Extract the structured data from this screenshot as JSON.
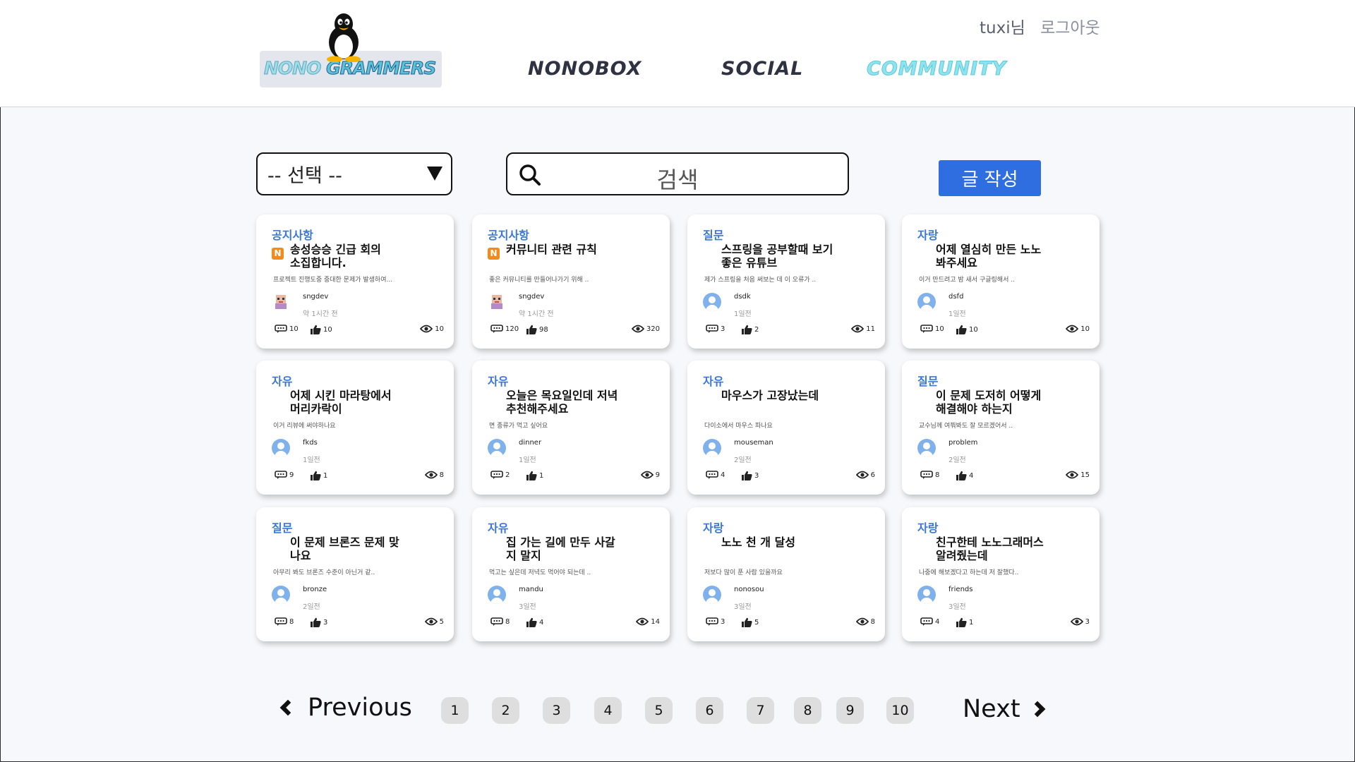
{
  "header": {
    "logo_part1": "NONO",
    "logo_part2": "GRAMMERS",
    "nav": [
      "NONOBOX",
      "SOCIAL",
      "COMMUNITY"
    ],
    "user_name": "tuxi님",
    "logout_label": "로그아웃",
    "active_nav": "COMMUNITY",
    "active_color": "#8fe3ee"
  },
  "toolbar": {
    "select_label": "-- 선택 --",
    "search_placeholder": "검색",
    "write_label": "글 작성",
    "accent_color": "#2f6ee0"
  },
  "posts": [
    {
      "category": "공지사항",
      "notice": true,
      "badge": "N",
      "title": "송성승승 긴급 회의\n소집합니다.",
      "excerpt": "프로젝트 진행도중 중대한 문제가 발생하여...",
      "author": "sngdev",
      "time": "약 1시간 전",
      "comments": "10",
      "likes": "10",
      "views": "10",
      "avatar": "pixel"
    },
    {
      "category": "공지사항",
      "notice": true,
      "badge": "N",
      "title": "커뮤니티 관련 규칙",
      "excerpt": "좋은 커뮤니티를 만들어나가기 위해 ..",
      "author": "sngdev",
      "time": "약 1시간 전",
      "comments": "120",
      "likes": "98",
      "views": "320",
      "avatar": "pixel"
    },
    {
      "category": "질문",
      "notice": false,
      "title": "스프링을 공부할때 보기\n좋은 유튜브",
      "excerpt": "제가 스프링을 처음 써보는 데 이 오류가 ..",
      "author": "dsdk",
      "time": "1일전",
      "comments": "3",
      "likes": "2",
      "views": "11",
      "avatar": "default"
    },
    {
      "category": "자랑",
      "notice": false,
      "title": "어제 열심히 만든 노노\n봐주세요",
      "excerpt": "이거 만드려고 밤 새서 구글링해서 ..",
      "author": "dsfd",
      "time": "1일전",
      "comments": "10",
      "likes": "10",
      "views": "10",
      "avatar": "default"
    },
    {
      "category": "자유",
      "notice": false,
      "title": "어제 시킨 마라탕에서\n머리카락이",
      "excerpt": "이거 리뷰에 써야하나요",
      "author": "fkds",
      "time": "1일전",
      "comments": "9",
      "likes": "1",
      "views": "8",
      "avatar": "default"
    },
    {
      "category": "자유",
      "notice": false,
      "title": "오늘은 목요일인데 저녁\n추천해주세요",
      "excerpt": "면 종류가 먹고 싶어요",
      "author": "dinner",
      "time": "1일전",
      "comments": "2",
      "likes": "1",
      "views": "9",
      "avatar": "default"
    },
    {
      "category": "자유",
      "notice": false,
      "title": "마우스가 고장났는데",
      "excerpt": "다이소에서 마우스 파나요",
      "author": "mouseman",
      "time": "2일전",
      "comments": "4",
      "likes": "3",
      "views": "6",
      "avatar": "default"
    },
    {
      "category": "질문",
      "notice": false,
      "title": "이 문제 도저히 어떻게\n해결해야 하는지",
      "excerpt": "교수님께 여쭤봐도 잘 모르겠어서 ..",
      "author": "problem",
      "time": "2일전",
      "comments": "8",
      "likes": "4",
      "views": "15",
      "avatar": "default"
    },
    {
      "category": "질문",
      "notice": false,
      "title": "이 문제 브론즈 문제 맞\n나요",
      "excerpt": "아무리 봐도 브론즈 수준이 아닌거 같..",
      "author": "bronze",
      "time": "2일전",
      "comments": "8",
      "likes": "3",
      "views": "5",
      "avatar": "default"
    },
    {
      "category": "자유",
      "notice": false,
      "title": "집 가는 길에 만두 사갈\n지 말지",
      "excerpt": "먹고는 싶은데 저녁도 먹어야 되는데 ..",
      "author": "mandu",
      "time": "3일전",
      "comments": "8",
      "likes": "4",
      "views": "14",
      "avatar": "default"
    },
    {
      "category": "자랑",
      "notice": false,
      "title": "노노 천 개 달성",
      "excerpt": "저보다 많이 푼 사람 있을까요",
      "author": "nonosou",
      "time": "3일전",
      "comments": "3",
      "likes": "5",
      "views": "8",
      "avatar": "default"
    },
    {
      "category": "자랑",
      "notice": false,
      "title": "친구한테 노노그래머스\n알려줬는데",
      "excerpt": "나중에 해보겠다고 하는데  저 잘했다..",
      "author": "friends",
      "time": "3일전",
      "comments": "4",
      "likes": "1",
      "views": "3",
      "avatar": "default"
    }
  ],
  "pagination": {
    "prev_label": "Previous",
    "next_label": "Next",
    "pages": [
      "1",
      "2",
      "3",
      "4",
      "5",
      "6",
      "7",
      "8",
      "9",
      "10"
    ]
  }
}
